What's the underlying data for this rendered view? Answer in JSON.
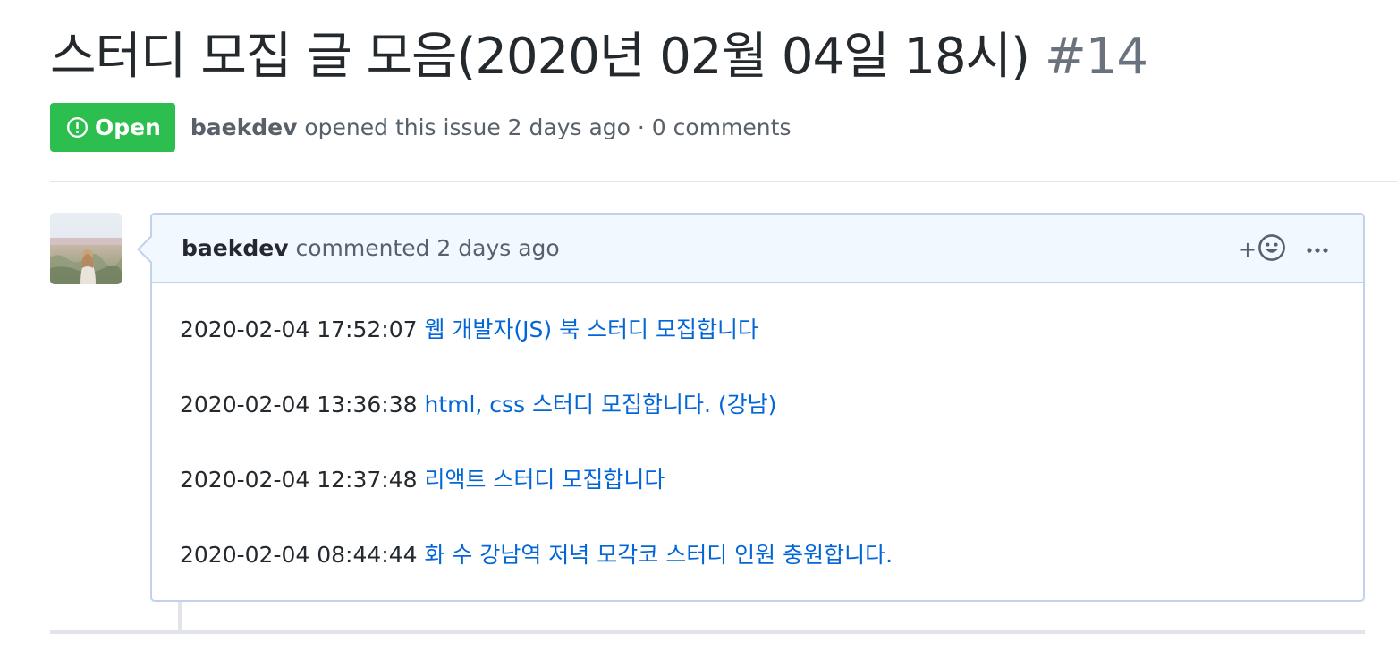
{
  "issue": {
    "title": "스터디 모집 글 모음(2020년 02월 04일 18시)",
    "number": "#14",
    "state": "Open",
    "author": "baekdev",
    "meta_suffix": "opened this issue 2 days ago · 0 comments"
  },
  "comment": {
    "author": "baekdev",
    "action": "commented 2 days ago",
    "reaction_plus": "+",
    "entries": [
      {
        "timestamp": "2020-02-04 17:52:07",
        "link_text": "웹 개발자(JS) 북 스터디 모집합니다"
      },
      {
        "timestamp": "2020-02-04 13:36:38",
        "link_text": "html, css 스터디 모집합니다. (강남)"
      },
      {
        "timestamp": "2020-02-04 12:37:48",
        "link_text": "리액트 스터디 모집합니다"
      },
      {
        "timestamp": "2020-02-04 08:44:44",
        "link_text": "화 수 강남역 저녁 모각코 스터디 인원 충원합니다."
      }
    ]
  },
  "icons": {
    "state": "issue-opened-icon",
    "reaction": "smiley-icon",
    "more": "kebab-horizontal-icon",
    "avatar": "user-avatar"
  },
  "colors": {
    "open_green": "#2cbe4e",
    "link_blue": "#0366d6",
    "header_blue_bg": "#f1f8ff",
    "header_blue_border": "#c0d3eb",
    "muted_text": "#586069",
    "number_gray": "#6a737d"
  }
}
